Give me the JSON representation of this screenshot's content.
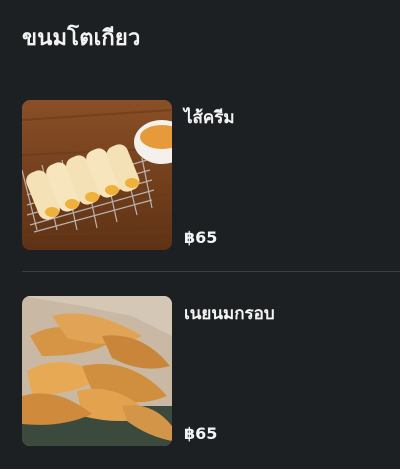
{
  "category": {
    "title": "ขนมโตเกียว"
  },
  "items": [
    {
      "name": "ไส้ครีม",
      "price": "฿65",
      "image_icon": "cream-filled-tokyo-rolls-photo"
    },
    {
      "name": "เนยนมกรอบ",
      "price": "฿65",
      "image_icon": "crispy-butter-milk-crisps-photo"
    }
  ]
}
